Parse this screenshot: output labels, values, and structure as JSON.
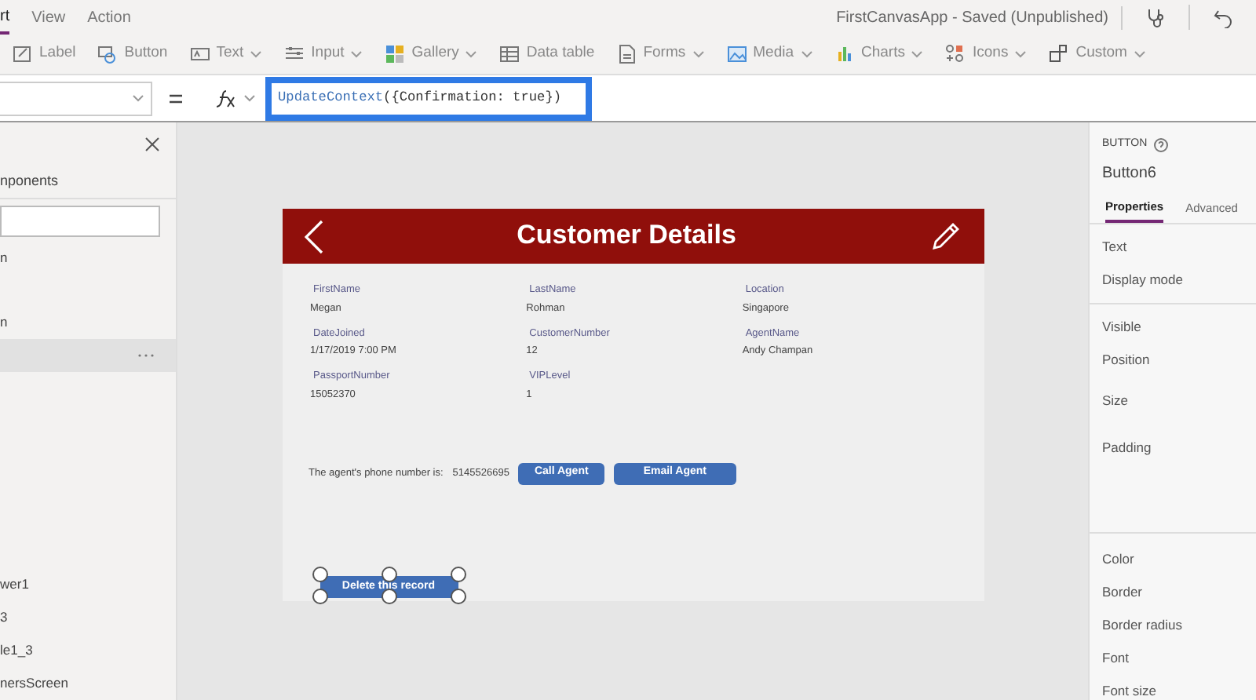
{
  "menu_tabs": [
    {
      "label": "rt",
      "selected": true
    },
    {
      "label": "View",
      "selected": false
    },
    {
      "label": "Action",
      "selected": false
    }
  ],
  "app_title": "FirstCanvasApp - Saved (Unpublished)",
  "ribbon": [
    {
      "label": "Label",
      "dropdown": false
    },
    {
      "label": "Button",
      "dropdown": false
    },
    {
      "label": "Text",
      "dropdown": true
    },
    {
      "label": "Input",
      "dropdown": true
    },
    {
      "label": "Gallery",
      "dropdown": true
    },
    {
      "label": "Data table",
      "dropdown": false
    },
    {
      "label": "Forms",
      "dropdown": true
    },
    {
      "label": "Media",
      "dropdown": true
    },
    {
      "label": "Charts",
      "dropdown": true
    },
    {
      "label": "Icons",
      "dropdown": true
    },
    {
      "label": "Custom",
      "dropdown": true
    }
  ],
  "formula": {
    "function": "UpdateContext",
    "arguments": "({Confirmation: true})"
  },
  "tree_panel": {
    "tab": "nponents",
    "items": [
      {
        "label": "n",
        "selected": false
      },
      {
        "label": "n",
        "selected": false
      },
      {
        "selected": true
      },
      {
        "label": "wer1",
        "selected": false
      },
      {
        "label": "3",
        "selected": false
      },
      {
        "label": "le1_3",
        "selected": false
      },
      {
        "label": "nersScreen",
        "selected": false
      }
    ]
  },
  "screen": {
    "title": "Customer Details",
    "fields": [
      {
        "label": "FirstName",
        "value": "Megan"
      },
      {
        "label": "LastName",
        "value": "Rohman"
      },
      {
        "label": "Location",
        "value": "Singapore"
      },
      {
        "label": "DateJoined",
        "value": "1/17/2019 7:00 PM"
      },
      {
        "label": "CustomerNumber",
        "value": "12"
      },
      {
        "label": "AgentName",
        "value": "Andy Champan"
      },
      {
        "label": "PassportNumber",
        "value": "15052370"
      },
      {
        "label": "VIPLevel",
        "value": "1"
      }
    ],
    "phone_label": "The agent's phone number is:",
    "phone": "5145526695",
    "buttons": [
      "Call Agent",
      "Email Agent"
    ],
    "delete_button": {
      "label": "Delete this record",
      "selected": true
    }
  },
  "properties_panel": {
    "type": "BUTTON",
    "name": "Button6",
    "tabs": [
      {
        "label": "Properties",
        "selected": true
      },
      {
        "label": "Advanced",
        "selected": false
      }
    ],
    "groups": [
      [
        "Text",
        "Display mode"
      ],
      [
        "Visible",
        "Position",
        "Size",
        "Padding"
      ],
      [
        "Color",
        "Border",
        "Border radius",
        "Font",
        "Font size"
      ]
    ]
  }
}
